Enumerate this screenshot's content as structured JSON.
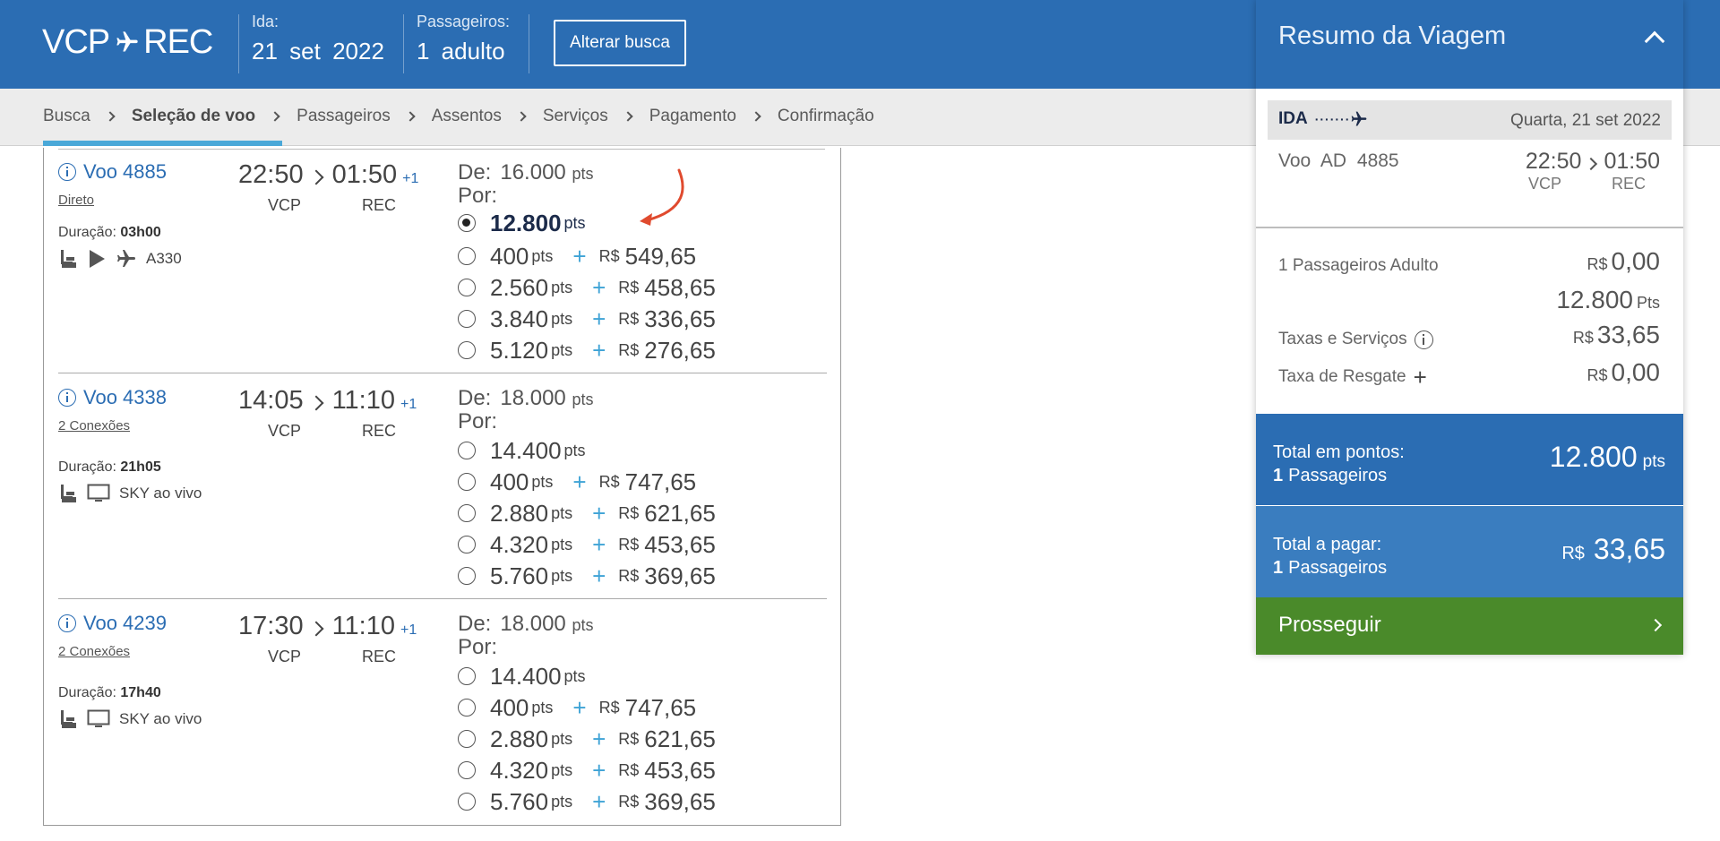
{
  "header": {
    "origin": "VCP",
    "destination": "REC",
    "ida_label": "Ida:",
    "ida_day": "21",
    "ida_month": "set",
    "ida_year": "2022",
    "passengers_label": "Passageiros:",
    "passengers_value": "1 adulto",
    "change_search_label": "Alterar busca",
    "brand_color": "#2b6db3"
  },
  "breadcrumbs": [
    "Busca",
    "Seleção de voo",
    "Passageiros",
    "Assentos",
    "Serviços",
    "Pagamento",
    "Confirmação"
  ],
  "active_step": "Seleção de voo",
  "flights": [
    {
      "number": "Voo 4885",
      "stops": "Direto",
      "duration_label": "Duração:",
      "duration": "03h00",
      "dep_time": "22:50",
      "arr_time": "01:50",
      "day_offset": "+1",
      "from": "VCP",
      "to": "REC",
      "amenity_text": "A330",
      "amenity_icons": [
        "seat-icon",
        "play-icon",
        "airplane-icon"
      ],
      "de_label": "De:",
      "de_pts": "16.000",
      "por_label": "Por:",
      "options": [
        {
          "pts": "12.800",
          "money": null,
          "selected": true
        },
        {
          "pts": "400",
          "money": "549,65",
          "selected": false
        },
        {
          "pts": "2.560",
          "money": "458,65",
          "selected": false
        },
        {
          "pts": "3.840",
          "money": "336,65",
          "selected": false
        },
        {
          "pts": "5.120",
          "money": "276,65",
          "selected": false
        }
      ]
    },
    {
      "number": "Voo 4338",
      "stops": "2 Conexões",
      "duration_label": "Duração:",
      "duration": "21h05",
      "dep_time": "14:05",
      "arr_time": "11:10",
      "day_offset": "+1",
      "from": "VCP",
      "to": "REC",
      "amenity_text": "SKY ao vivo",
      "amenity_icons": [
        "seat-icon",
        "monitor-icon"
      ],
      "de_label": "De:",
      "de_pts": "18.000",
      "por_label": "Por:",
      "options": [
        {
          "pts": "14.400",
          "money": null,
          "selected": false
        },
        {
          "pts": "400",
          "money": "747,65",
          "selected": false
        },
        {
          "pts": "2.880",
          "money": "621,65",
          "selected": false
        },
        {
          "pts": "4.320",
          "money": "453,65",
          "selected": false
        },
        {
          "pts": "5.760",
          "money": "369,65",
          "selected": false
        }
      ]
    },
    {
      "number": "Voo 4239",
      "stops": "2 Conexões",
      "duration_label": "Duração:",
      "duration": "17h40",
      "dep_time": "17:30",
      "arr_time": "11:10",
      "day_offset": "+1",
      "from": "VCP",
      "to": "REC",
      "amenity_text": "SKY ao vivo",
      "amenity_icons": [
        "seat-icon",
        "monitor-icon"
      ],
      "de_label": "De:",
      "de_pts": "18.000",
      "por_label": "Por:",
      "options": [
        {
          "pts": "14.400",
          "money": null,
          "selected": false
        },
        {
          "pts": "400",
          "money": "747,65",
          "selected": false
        },
        {
          "pts": "2.880",
          "money": "621,65",
          "selected": false
        },
        {
          "pts": "4.320",
          "money": "453,65",
          "selected": false
        },
        {
          "pts": "5.760",
          "money": "369,65",
          "selected": false
        }
      ]
    }
  ],
  "units": {
    "pts": "pts",
    "currency": "R$",
    "plus": "+"
  },
  "summary": {
    "title": "Resumo da Viagem",
    "ida_label": "IDA",
    "ida_date": "Quarta, 21  set 2022",
    "voo_label": "Voo  AD 4885",
    "dep_time": "22:50",
    "arr_time": "01:50",
    "from": "VCP",
    "to": "REC",
    "passengers_line": "1 Passageiros Adulto",
    "passengers_money": "0,00",
    "passengers_pts": "12.800",
    "passengers_pts_unit": "Pts",
    "taxas_label": "Taxas e Serviços",
    "taxas_value": "33,65",
    "resgate_label": "Taxa de Resgate",
    "resgate_value": "0,00",
    "total_pts_label": "Total em pontos:",
    "total_pts_value": "12.800",
    "total_pay_label": "Total a pagar:",
    "total_pay_value": "33,65",
    "pax_count": "1",
    "pax_word": "Passageiros",
    "proceed_label": "Prosseguir",
    "proceed_color": "#4a8a2a"
  }
}
